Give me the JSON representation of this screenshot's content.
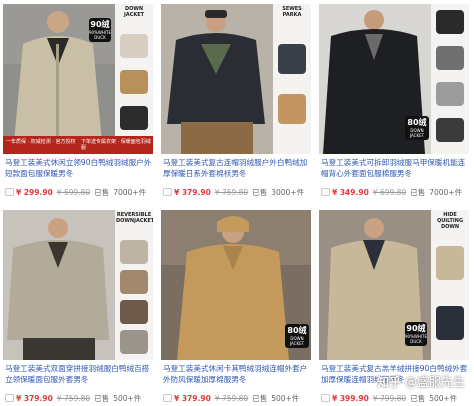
{
  "products": [
    {
      "title": "马登工装美式休闲立领90白鸭绒羽绒服户外短款面包服保暖男冬",
      "price": "299.90",
      "original_price": "599.80",
      "sold_label": "已售",
      "sold_count": "7000+件",
      "image": {
        "header": "DOWN JACKET",
        "badge_main": "90绒",
        "badge_sub": "90%WHITE DUCK",
        "banner_left": "一年质保 · 权威检测 · 官方授权",
        "banner_right": "下单送专属衣架 · 保暖面包羽绒服",
        "jacket_color": "#c9bfa6",
        "thumb_colors": [
          "#d6cfc1",
          "#b8905a",
          "#2c2c2c"
        ]
      }
    },
    {
      "title": "马登工装美式复古连帽羽绒服户外白鸭绒加厚保暖日系外套棉袄男冬",
      "price": "379.90",
      "original_price": "759.80",
      "sold_label": "已售",
      "sold_count": "3000+件",
      "image": {
        "header": "SEWES PARKA",
        "jacket_color": "#2a2d33",
        "thumb_colors": [
          "#3a3f4a",
          "#c39560"
        ]
      }
    },
    {
      "title": "马登工装美式可拆卸羽绒服马甲保暖机能连帽背心外套面包服棉服男冬",
      "price": "349.90",
      "original_price": "699.80",
      "sold_label": "已售",
      "sold_count": "7000+件",
      "image": {
        "badge_main": "80绒",
        "badge_sub": "DOWN JACKET",
        "jacket_color": "#1e1f22",
        "thumb_colors": [
          "#2a2a2a",
          "#707070",
          "#9c9c9c",
          "#3b3b3b"
        ]
      }
    },
    {
      "title": "马登工装美式双面穿拼接羽绒服白鸭绒百搭立领保暖面包服外套男冬",
      "price": "379.90",
      "original_price": "759.80",
      "sold_label": "已售",
      "sold_count": "500+件",
      "image": {
        "header": "REVERSIBLE DOWNJACKET",
        "jacket_color": "#b3ab99",
        "thumb_colors": [
          "#bdb5a3",
          "#a4886d",
          "#6e5a4a",
          "#9a948a"
        ]
      }
    },
    {
      "title": "马登工装美式休闲卡其鸭绒羽绒连帽外套户外防风保暖加厚棉服男冬",
      "price": "379.90",
      "original_price": "759.80",
      "sold_label": "已售",
      "sold_count": "500+件",
      "image": {
        "badge_main": "80绒",
        "badge_sub": "DOWN JACKET",
        "jacket_color": "#c49a5c"
      }
    },
    {
      "title": "马登工装美式复古羔羊绒拼接90白鸭绒外套加厚保暖连帽羽绒服男冬",
      "price": "399.90",
      "original_price": "799.80",
      "sold_label": "已售",
      "sold_count": "500+件",
      "image": {
        "header": "HIDE QUILTING DOWN",
        "badge_main": "90绒",
        "badge_sub": "90%WHITE DUCK",
        "jacket_color": "#c8b89a",
        "thumb_colors": [
          "#c8b89a",
          "#2b2f3a"
        ]
      }
    }
  ],
  "watermark": {
    "site": "知乎",
    "handle": "@盛服先生"
  }
}
